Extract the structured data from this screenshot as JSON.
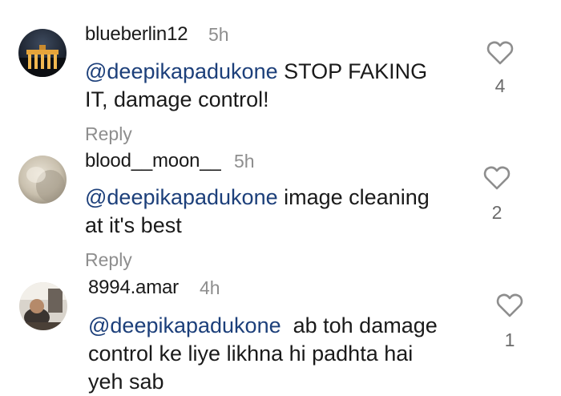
{
  "comments": [
    {
      "username": "blueberlin12",
      "time": "5h",
      "mention": "@deepikapadukone",
      "text_line1": " STOP FAKING",
      "text_line2": "IT, damage control!",
      "reply_label": "Reply",
      "likes": "4",
      "avatar_desc": "brandenburg-gate-night"
    },
    {
      "username": "blood__moon__",
      "time": "5h",
      "mention": "@deepikapadukone",
      "text_line1": " image cleaning",
      "text_line2": "at it's best",
      "reply_label": "Reply",
      "likes": "2",
      "avatar_desc": "beige-blurred"
    },
    {
      "username": "8994.amar",
      "time": "4h",
      "mention": "@deepikapadukone",
      "text_line1": "  ab toh damage",
      "text_line2": "control ke liye likhna hi padhta hai",
      "text_line3": "yeh sab",
      "likes": "1",
      "avatar_desc": "person-photo"
    }
  ],
  "colors": {
    "mention": "#1c3f7a",
    "muted": "#8e8e8e"
  },
  "icons": {
    "like": "heart-outline-icon"
  }
}
